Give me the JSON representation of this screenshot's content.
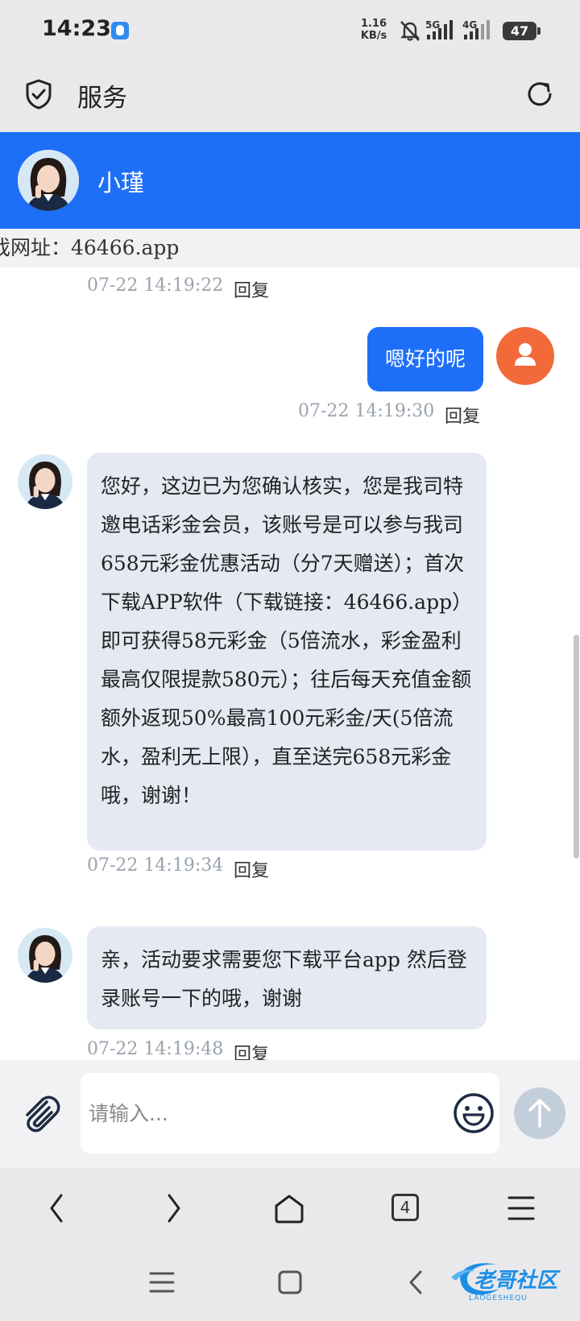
{
  "status_bar": {
    "time": "14:23",
    "net_speed_value": "1.16",
    "net_speed_unit": "KB/s",
    "network_1": "5G",
    "network_2": "4G",
    "battery": "47"
  },
  "app_bar": {
    "title": "服务"
  },
  "chat_header": {
    "agent_name": "小瑾"
  },
  "notice": {
    "text": "戏网址：46466.app"
  },
  "messages": [
    {
      "direction": "in",
      "timestamp": "07-22 14:19:22",
      "reply_label": "回复"
    },
    {
      "direction": "out",
      "text": "嗯好的呢",
      "timestamp": "07-22 14:19:30",
      "reply_label": "回复"
    },
    {
      "direction": "in",
      "text": "您好，这边已为您确认核实，您是我司特邀电话彩金会员，该账号是可以参与我司658元彩金优惠活动（分7天赠送）；首次下载APP软件（下载链接：46466.app）即可获得58元彩金（5倍流水，彩金盈利最高仅限提款580元）；往后每天充值金额额外返现50%最高100元彩金/天(5倍流水，盈利无上限），直至送完658元彩金哦，谢谢！",
      "timestamp": "07-22 14:19:34",
      "reply_label": "回复"
    },
    {
      "direction": "in",
      "text": "亲，活动要求需要您下载平台app 然后登录账号一下的哦，谢谢",
      "timestamp": "07-22 14:19:48",
      "reply_label": "回复"
    }
  ],
  "input": {
    "placeholder": "请输入..."
  },
  "browser": {
    "tab_count": "4"
  },
  "watermark": {
    "text": "老哥社区",
    "subtext": "LAOGESHEQU"
  },
  "colors": {
    "accent": "#1e6ff8",
    "user_avatar": "#f26a3a",
    "bubble_in": "#e4e9f2",
    "send_button": "#c3cedb"
  }
}
